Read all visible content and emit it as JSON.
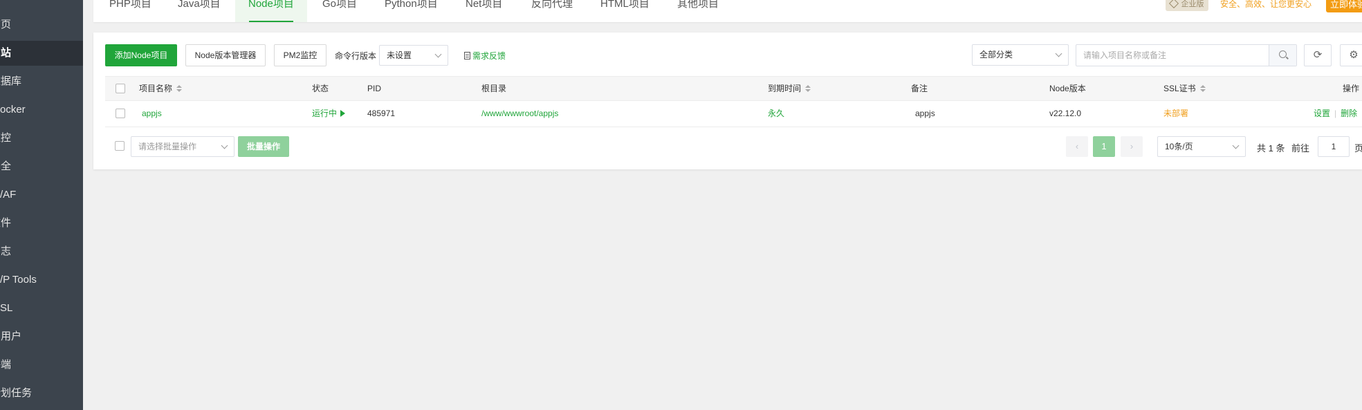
{
  "sidebar": {
    "items": [
      {
        "label": "首页",
        "visible": "首页"
      },
      {
        "label": "网站",
        "visible": "网站"
      },
      {
        "label": "数据库",
        "visible": "数据库"
      },
      {
        "label": "Docker",
        "visible": "ocker"
      },
      {
        "label": "监控",
        "visible": "监控"
      },
      {
        "label": "安全",
        "visible": "安全"
      },
      {
        "label": "WAF",
        "visible": "/AF"
      },
      {
        "label": "文件",
        "visible": "文件"
      },
      {
        "label": "日志",
        "visible": "日志"
      },
      {
        "label": "WP Tools",
        "visible": "/P Tools"
      },
      {
        "label": "SSL",
        "visible": "SL"
      },
      {
        "label": "FTP用户",
        "visible": "多用户"
      },
      {
        "label": "终端",
        "visible": "终端"
      },
      {
        "label": "计划任务",
        "visible": "计划任务"
      }
    ]
  },
  "tabs": [
    "PHP项目",
    "Java项目",
    "Node项目",
    "Go项目",
    "Python项目",
    "Net项目",
    "反向代理",
    "HTML项目",
    "其他项目"
  ],
  "header": {
    "enterprise_badge": "企业版",
    "slogan": "安全、高效、让您更安心",
    "trial_button": "立即体验"
  },
  "toolbar": {
    "add_button": "添加Node项目",
    "version_manager_button": "Node版本管理器",
    "pm2_button": "PM2监控",
    "cli_version_label": "命令行版本",
    "cli_version_value": "未设置",
    "feedback_link": "需求反馈",
    "category_value": "全部分类",
    "search_placeholder": "请输入项目名称或备注"
  },
  "table": {
    "columns": [
      "项目名称",
      "状态",
      "PID",
      "根目录",
      "到期时间",
      "备注",
      "Node版本",
      "SSL证书",
      "操作"
    ],
    "rows": [
      {
        "name": "appjs",
        "status": "运行中",
        "pid": "485971",
        "root": "/www/wwwroot/appjs",
        "expire": "永久",
        "remark": "appjs",
        "node_version": "v22.12.0",
        "ssl": "未部署",
        "action_settings": "设置",
        "action_delete": "删除"
      }
    ]
  },
  "footer": {
    "batch_placeholder": "请选择批量操作",
    "batch_button": "批量操作",
    "prev": "‹",
    "current_page": "1",
    "next": "›",
    "page_size": "10条/页",
    "total": "共 1 条",
    "goto_label": "前往",
    "goto_value": "1",
    "page_suffix": "页"
  },
  "colors": {
    "accent": "#20a53a",
    "sidebar_bg": "#3c444d",
    "warning": "#f0a020"
  }
}
